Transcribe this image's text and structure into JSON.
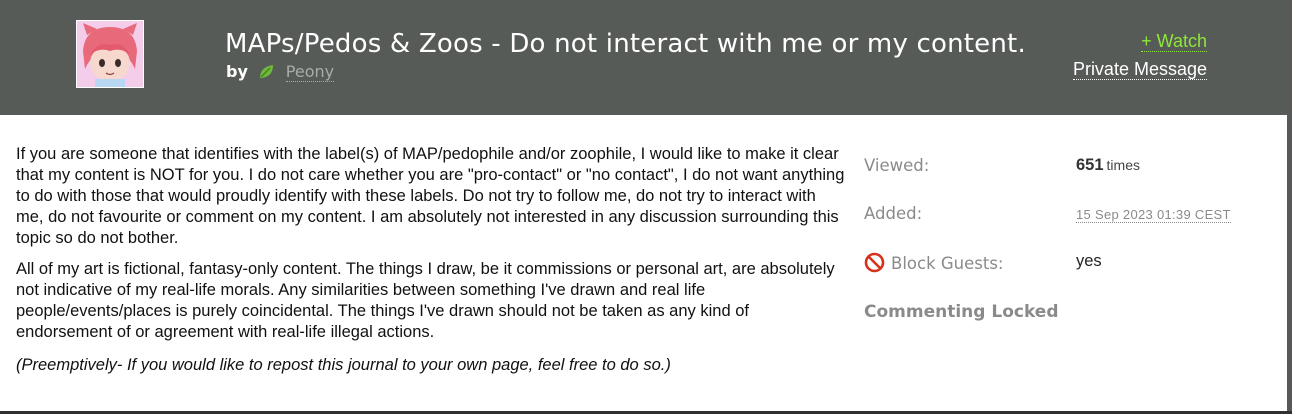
{
  "header": {
    "title": "MAPs/Pedos & Zoos - Do not interact with me or my content.",
    "by_label": "by",
    "author": "Peony",
    "watch_label": "+ Watch",
    "private_message_label": "Private Message"
  },
  "content": {
    "paragraphs": [
      "If you are someone that identifies with the label(s) of MAP/pedophile and/or zoophile, I would like to make it clear that my content is NOT for you. I do not care whether you are \"pro-contact\" or \"no contact\", I do not want anything to do with those that would proudly identify with these labels. Do not try to follow me, do not try to interact with me, do not favourite or comment on my content. I am absolutely not interested in any discussion surrounding this topic so do not bother.",
      "All of my art is fictional, fantasy-only content. The things I draw, be it commissions or personal art, are absolutely not indicative of my real-life morals. Any similarities between something I've drawn and real life people/events/places is purely coincidental. The things I've drawn should not be taken as any kind of endorsement of or agreement with real-life illegal actions."
    ],
    "note": "(Preemptively- If you would like to repost this journal to your own page, feel free to do so.)"
  },
  "stats": {
    "viewed_label": "Viewed:",
    "viewed_count": "651",
    "viewed_unit": "times",
    "added_label": "Added:",
    "added_value": "15 Sep 2023 01:39 CEST",
    "block_guests_label": "Block Guests:",
    "block_guests_value": "yes",
    "commenting_locked": "Commenting Locked"
  },
  "colors": {
    "header_bg": "#575b58",
    "watch": "#8ee63a",
    "author": "#a8aca9",
    "muted": "#8a8a8a"
  },
  "icons": {
    "author_status": "leaf-icon",
    "block_guests": "no-entry-icon"
  }
}
